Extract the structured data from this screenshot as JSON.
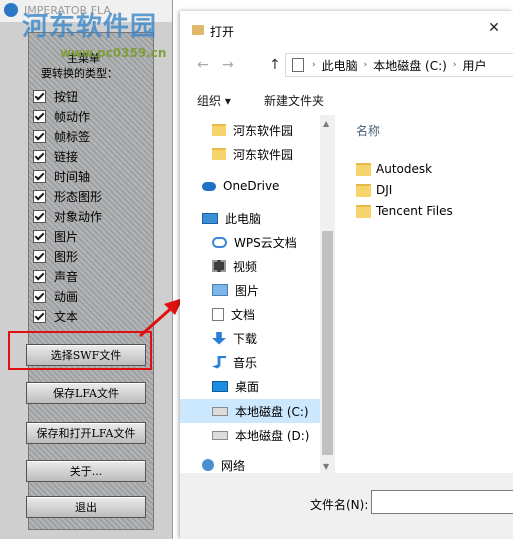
{
  "app": {
    "title": "IMPERATOR FLA",
    "menu_title": "主菜单",
    "menu_subtitle": "要转换的类型：",
    "types": [
      {
        "label": "按钮",
        "checked": true
      },
      {
        "label": "帧动作",
        "checked": true
      },
      {
        "label": "帧标签",
        "checked": true
      },
      {
        "label": "链接",
        "checked": true
      },
      {
        "label": "时间轴",
        "checked": true
      },
      {
        "label": "形态图形",
        "checked": true
      },
      {
        "label": "对象动作",
        "checked": true
      },
      {
        "label": "图片",
        "checked": true
      },
      {
        "label": "图形",
        "checked": true
      },
      {
        "label": "声音",
        "checked": true
      },
      {
        "label": "动画",
        "checked": true
      },
      {
        "label": "文本",
        "checked": true
      }
    ],
    "buttons": {
      "select_swf": "选择SWF文件",
      "save_lfa": "保存LFA文件",
      "save_open_lfa": "保存和打开LFA文件",
      "about": "关于...",
      "exit": "退出"
    },
    "highlight_color": "#e01010"
  },
  "dialog": {
    "title": "打开",
    "close_glyph": "✕",
    "nav": {
      "back": "←",
      "forward": "→",
      "up": "↑"
    },
    "breadcrumbs": [
      "此电脑",
      "本地磁盘 (C:)",
      "用户"
    ],
    "breadcrumb_sep": "›",
    "toolbar": {
      "organize": "组织 ▾",
      "new_folder": "新建文件夹"
    },
    "sidebar": [
      {
        "label": "河东软件园",
        "icon": "folder-icon"
      },
      {
        "label": "河东软件园",
        "icon": "folder-icon"
      },
      {
        "label": "OneDrive",
        "icon": "cloud-icon"
      },
      {
        "label": "此电脑",
        "icon": "computer-icon"
      },
      {
        "label": "WPS云文档",
        "icon": "cloud-outline-icon"
      },
      {
        "label": "视频",
        "icon": "video-icon"
      },
      {
        "label": "图片",
        "icon": "picture-icon"
      },
      {
        "label": "文档",
        "icon": "document-icon"
      },
      {
        "label": "下载",
        "icon": "download-icon"
      },
      {
        "label": "音乐",
        "icon": "music-icon"
      },
      {
        "label": "桌面",
        "icon": "desktop-icon"
      },
      {
        "label": "本地磁盘 (C:)",
        "icon": "drive-icon",
        "selected": true
      },
      {
        "label": "本地磁盘 (D:)",
        "icon": "drive-icon"
      },
      {
        "label": "网络",
        "icon": "network-icon"
      }
    ],
    "column_name": "名称",
    "files": [
      {
        "name": "Autodesk"
      },
      {
        "name": "DJI"
      },
      {
        "name": "Tencent Files"
      }
    ],
    "filename_label": "文件名(N):",
    "filename_value": ""
  },
  "watermark": {
    "text": "河东软件园",
    "url": "www.pc0359.cn"
  }
}
